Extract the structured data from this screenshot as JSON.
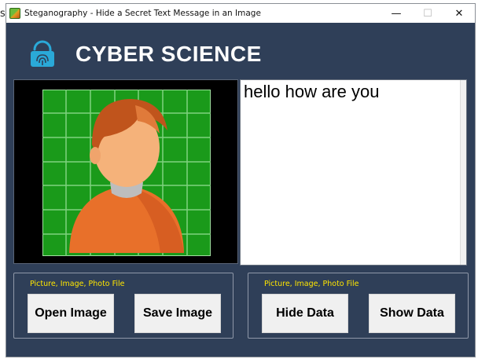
{
  "stray_text": "s",
  "window": {
    "title": "Steganography - Hide a Secret Text Message in an Image",
    "controls": {
      "minimize": "—",
      "maximize": "☐",
      "close": "✕"
    }
  },
  "header": {
    "logo_icon": "fingerprint-lock-icon",
    "title": "CYBER SCIENCE"
  },
  "image_panel": {
    "image_icon": "person-avatar-icon",
    "colors": {
      "grid_bg": "#1a9a1a",
      "grid_line": "#7fd27f",
      "body": "#e8702a",
      "face": "#f5b27a",
      "hair": "#c0541c"
    }
  },
  "message": {
    "text": "hello how are you"
  },
  "left_group": {
    "label": "Picture, Image, Photo File",
    "open_button": "Open Image",
    "save_button": "Save Image"
  },
  "right_group": {
    "label": "Picture, Image, Photo File",
    "hide_button": "Hide Data",
    "show_button": "Show Data"
  },
  "colors": {
    "window_bg": "#2f3f58",
    "label_yellow": "#ffe600",
    "button_bg": "#f0f0f0",
    "icon_cyan": "#2aa9d8"
  }
}
